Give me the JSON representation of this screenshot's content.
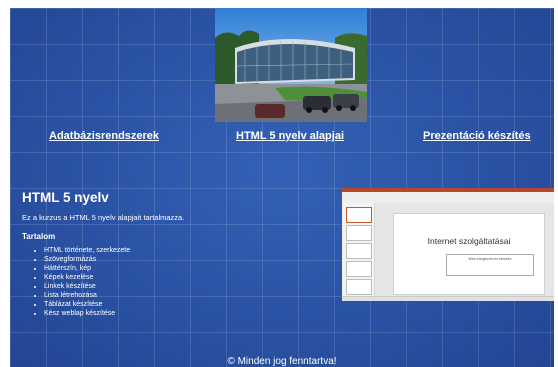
{
  "nav": {
    "link1": "Adatbázisrendszerek",
    "link2": "HTML 5 nyelv alapjai",
    "link3": "Prezentáció készítés"
  },
  "main": {
    "title": "HTML 5 nyelv",
    "intro": "Ez a kurzus a HTML 5 nyelv alapjait tartalmazza.",
    "toc_title": "Tartalom",
    "toc_items": [
      "HTML története, szerkezete",
      "Szövegformázás",
      "Háttérszín, kép",
      "Képek kezelése",
      "Linkek készítése",
      "Lista létrehozása",
      "Táblázat készítése",
      "Kész weblap készítése"
    ]
  },
  "screenshot": {
    "slide_title": "Internet szolgáltatásai",
    "slide_subtitle": "Web böngészés és keresés"
  },
  "footer": {
    "text": "© Minden jog fenntartva!"
  },
  "colors": {
    "background": "#2a55a8",
    "text": "#ffffff",
    "ppt_accent": "#b7472a"
  }
}
